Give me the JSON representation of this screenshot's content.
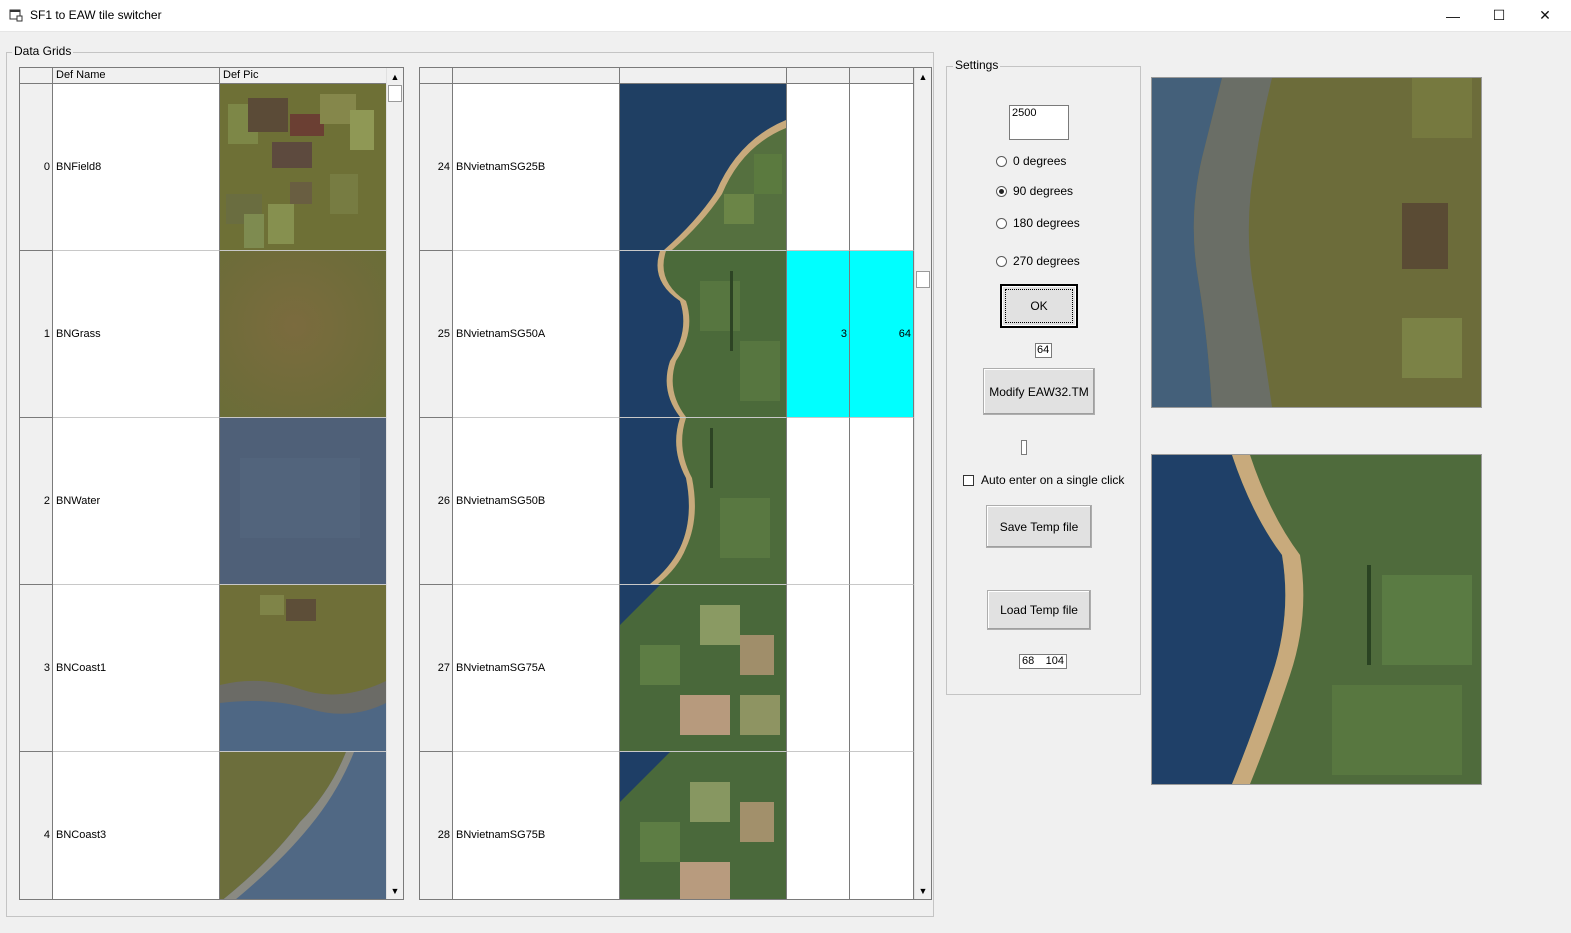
{
  "window": {
    "title": "SF1 to EAW tile switcher",
    "minimize_glyph": "—",
    "maximize_glyph": "☐",
    "close_glyph": "✕"
  },
  "data_grids": {
    "label": "Data Grids",
    "left_grid": {
      "columns": [
        "Def Name",
        "Def Pic"
      ],
      "rows": [
        {
          "index": "0",
          "name": "BNField8",
          "pic": "field-tile"
        },
        {
          "index": "1",
          "name": "BNGrass",
          "pic": "grass-tile"
        },
        {
          "index": "2",
          "name": "BNWater",
          "pic": "water-tile"
        },
        {
          "index": "3",
          "name": "BNCoast1",
          "pic": "coast-tile"
        },
        {
          "index": "4",
          "name": "BNCoast3",
          "pic": "coast-corner-tile"
        }
      ]
    },
    "right_grid": {
      "columns": [
        "",
        "",
        "",
        ""
      ],
      "rows": [
        {
          "index": "24",
          "name": "BNvietnamSG25B",
          "pic": "vietnam-coast-tile",
          "c3": "",
          "c4": ""
        },
        {
          "index": "25",
          "name": "BNvietnamSG50A",
          "pic": "vietnam-coast-tile",
          "c3": "3",
          "c4": "64",
          "selected": true
        },
        {
          "index": "26",
          "name": "BNvietnamSG50B",
          "pic": "vietnam-coast-tile",
          "c3": "",
          "c4": ""
        },
        {
          "index": "27",
          "name": "BNvietnamSG75A",
          "pic": "vietnam-fields-tile",
          "c3": "",
          "c4": ""
        },
        {
          "index": "28",
          "name": "BNvietnamSG75B",
          "pic": "vietnam-fields-tile",
          "c3": "",
          "c4": ""
        }
      ]
    },
    "scroll_up_glyph": "▲",
    "scroll_down_glyph": "▼"
  },
  "settings": {
    "label": "Settings",
    "value_input": "2500",
    "rotation_options": [
      "0 degrees",
      "90 degrees",
      "180 degrees",
      "270 degrees"
    ],
    "rotation_selected": "90 degrees",
    "ok_label": "OK",
    "small_value": "64",
    "modify_label": "Modify EAW32.TM",
    "tiny_value": "",
    "auto_enter_label": "Auto enter on a single click",
    "auto_enter_checked": false,
    "save_label": "Save Temp file",
    "load_label": "Load Temp file",
    "coord_a": "68",
    "coord_b": "104"
  },
  "colors": {
    "selection": "#00ffff",
    "window_bg": "#f0f0f0"
  }
}
